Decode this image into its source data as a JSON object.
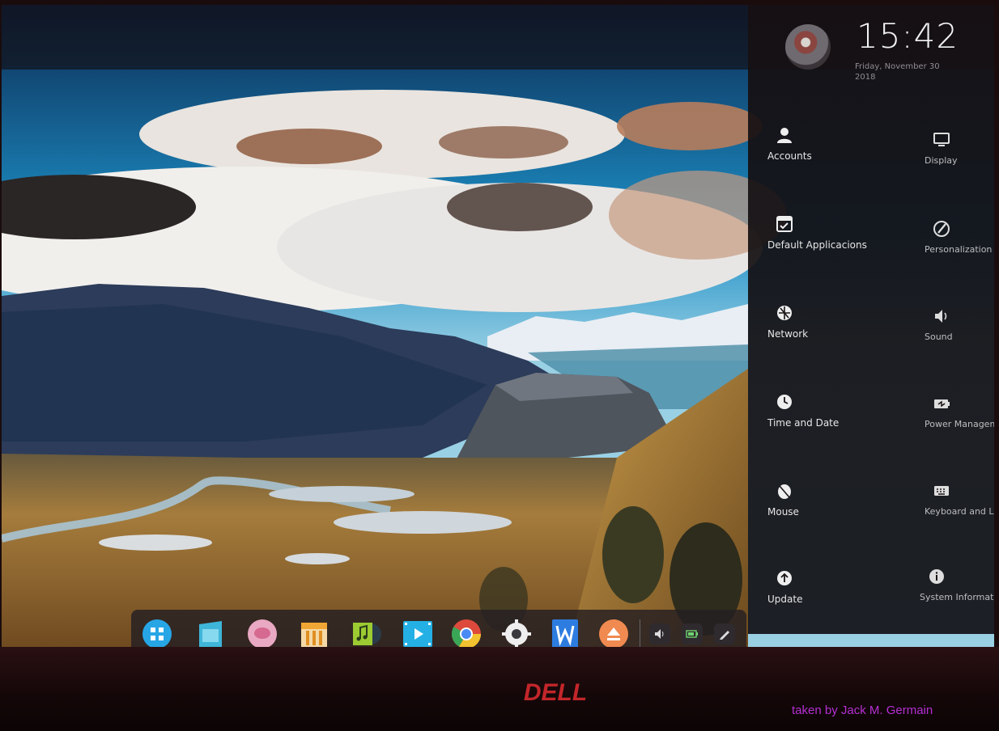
{
  "panel": {
    "time": "15:42",
    "date_line1": "Friday, November 30",
    "date_line2": "2018",
    "items_left": [
      {
        "label": "Accounts",
        "icon": "user-icon"
      },
      {
        "label": "Default Applicacions",
        "icon": "checkbox-icon"
      },
      {
        "label": "Network",
        "icon": "network-icon"
      },
      {
        "label": "Time and Date",
        "icon": "clock-icon"
      },
      {
        "label": "Mouse",
        "icon": "mouse-icon"
      },
      {
        "label": "Update",
        "icon": "update-icon"
      }
    ],
    "items_right": [
      {
        "label": "Display",
        "icon": "monitor-icon"
      },
      {
        "label": "Personalization",
        "icon": "palette-icon"
      },
      {
        "label": "Sound",
        "icon": "speaker-icon"
      },
      {
        "label": "Power Manageme",
        "icon": "battery-icon"
      },
      {
        "label": "Keyboard and Lan",
        "icon": "keyboard-icon"
      },
      {
        "label": "System Informatio",
        "icon": "info-icon"
      }
    ]
  },
  "dock": {
    "apps": [
      {
        "name": "launcher-icon",
        "color": "#27a6e6"
      },
      {
        "name": "app-store-icon",
        "color": "#3fb5d9"
      },
      {
        "name": "chat-icon",
        "color": "#e9a9c2"
      },
      {
        "name": "file-manager-icon",
        "color": "#f0a634"
      },
      {
        "name": "music-player-icon",
        "color": "#9ccb32"
      },
      {
        "name": "video-player-icon",
        "color": "#24b0e5"
      },
      {
        "name": "chrome-icon",
        "color": "#dd4a3b"
      },
      {
        "name": "settings-icon",
        "color": "#eeeeee"
      },
      {
        "name": "wps-writer-icon",
        "color": "#2d7de0"
      },
      {
        "name": "disk-eject-icon",
        "color": "#f08a50"
      }
    ],
    "tray": [
      "volume-icon",
      "battery-icon",
      "pen-icon"
    ]
  },
  "bezel": {
    "brand": "DELL"
  },
  "credit": "taken by Jack M. Germain",
  "colors": {
    "panel_bg": "#161214",
    "credit": "#b52fd4",
    "brand_red": "#c2262a"
  }
}
